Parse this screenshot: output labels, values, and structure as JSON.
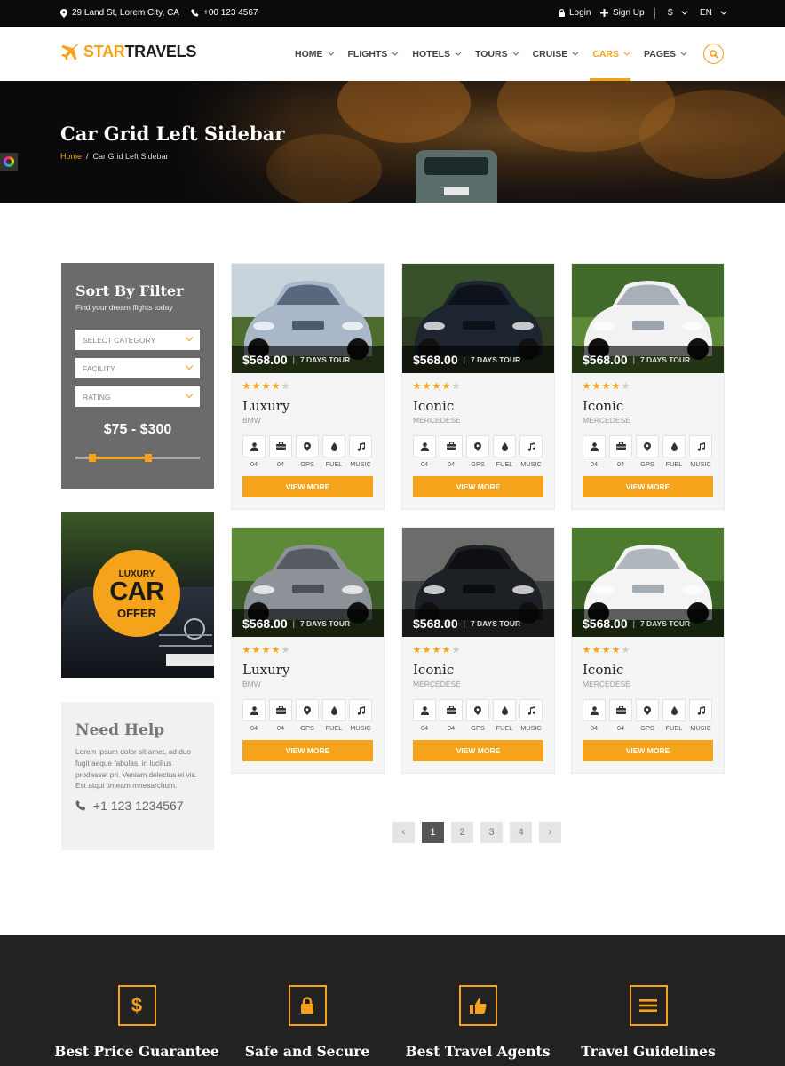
{
  "topbar": {
    "address": "29 Land St, Lorem City, CA",
    "phone": "+00 123 4567",
    "login": "Login",
    "signup": "Sign Up",
    "currency": "$",
    "language": "EN"
  },
  "brand": {
    "part1": "STAR",
    "part2": "TRAVELS"
  },
  "nav": [
    "HOME",
    "FLIGHTS",
    "HOTELS",
    "TOURS",
    "CRUISE",
    "CARS",
    "PAGES"
  ],
  "nav_active": "CARS",
  "hero": {
    "title": "Car Grid Left Sidebar",
    "breadcrumb_home": "Home",
    "breadcrumb_sep": "/",
    "breadcrumb_current": "Car Grid Left Sidebar"
  },
  "filter": {
    "title": "Sort By Filter",
    "subtitle": "Find your dream flights today",
    "selects": [
      "SELECT CATEGORY",
      "FACILITY",
      "RATING"
    ],
    "price_range": "$75 - $300"
  },
  "promo": {
    "line1": "LUXURY",
    "line2": "CAR",
    "line3": "OFFER"
  },
  "help": {
    "title": "Need Help",
    "text": "Lorem ipsum dolor sit amet, ad duo fugit aeque fabulas, in lucilius prodesset pri. Veniam delectus ei vis. Est atqui timeam mnesarchum.",
    "phone": "+1 123 1234567"
  },
  "cars": [
    {
      "price": "$568.00",
      "tour": "7 DAYS TOUR",
      "rating": 4,
      "name": "Luxury",
      "brand": "BMW",
      "button": "VIEW MORE"
    },
    {
      "price": "$568.00",
      "tour": "7 DAYS TOUR",
      "rating": 4,
      "name": "Iconic",
      "brand": "MERCEDESE",
      "button": "VIEW MORE"
    },
    {
      "price": "$568.00",
      "tour": "7 DAYS TOUR",
      "rating": 4,
      "name": "Iconic",
      "brand": "MERCEDESE",
      "button": "VIEW MORE"
    },
    {
      "price": "$568.00",
      "tour": "7 DAYS TOUR",
      "rating": 4,
      "name": "Luxury",
      "brand": "BMW",
      "button": "VIEW MORE"
    },
    {
      "price": "$568.00",
      "tour": "7 DAYS TOUR",
      "rating": 4,
      "name": "Iconic",
      "brand": "MERCEDESE",
      "button": "VIEW MORE"
    },
    {
      "price": "$568.00",
      "tour": "7 DAYS TOUR",
      "rating": 4,
      "name": "Iconic",
      "brand": "MERCEDESE",
      "button": "VIEW MORE"
    }
  ],
  "features": [
    {
      "icon": "person-icon",
      "label": "04"
    },
    {
      "icon": "briefcase-icon",
      "label": "04"
    },
    {
      "icon": "map-pin-icon",
      "label": "GPS"
    },
    {
      "icon": "fuel-drop-icon",
      "label": "FUEL"
    },
    {
      "icon": "music-icon",
      "label": "MUSIC"
    }
  ],
  "pagination": {
    "prev": "‹",
    "pages": [
      "1",
      "2",
      "3",
      "4"
    ],
    "active": "1",
    "next": "›"
  },
  "footer_features": [
    {
      "icon": "dollar-icon",
      "title": "Best Price Guarantee"
    },
    {
      "icon": "lock-icon",
      "title": "Safe and Secure"
    },
    {
      "icon": "thumbs-up-icon",
      "title": "Best Travel Agents"
    },
    {
      "icon": "list-icon",
      "title": "Travel Guidelines"
    }
  ],
  "colors": {
    "accent": "#f5a31a",
    "dark": "#222222",
    "topbar": "#0b0b0b",
    "filter_bg": "#6b6b6b"
  }
}
